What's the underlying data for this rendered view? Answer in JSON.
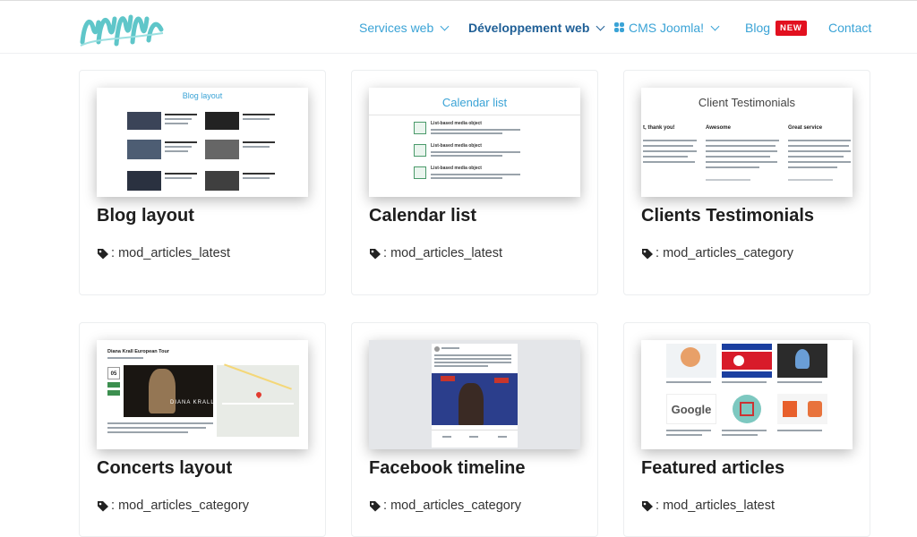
{
  "nav": {
    "items": [
      {
        "label": "Services web"
      },
      {
        "label": "Développement web"
      },
      {
        "label": "CMS Joomla!"
      },
      {
        "label": "Blog",
        "badge": "NEW"
      },
      {
        "label": "Contact"
      }
    ]
  },
  "cards": [
    {
      "title": "Blog layout",
      "tag_prefix": ":",
      "tag": "mod_articles_latest",
      "thumb_heading": "Blog layout"
    },
    {
      "title": "Calendar list",
      "tag_prefix": ":",
      "tag": "mod_articles_latest",
      "thumb_heading": "Calendar list"
    },
    {
      "title": "Clients Testimonials",
      "tag_prefix": ":",
      "tag": "mod_articles_category",
      "thumb_heading": "Client Testimonials"
    },
    {
      "title": "Concerts layout",
      "tag_prefix": ":",
      "tag": "mod_articles_category",
      "thumb_heading": "Diana Krall European Tour"
    },
    {
      "title": "Facebook timeline",
      "tag_prefix": ":",
      "tag": "mod_articles_category",
      "thumb_heading": ""
    },
    {
      "title": "Featured articles",
      "tag_prefix": ":",
      "tag": "mod_articles_latest",
      "thumb_heading": ""
    }
  ],
  "thumbs": {
    "calendar_items": [
      "List-based media object",
      "List-based media object",
      "List-based media object"
    ],
    "testimonial_cols": [
      "Awesome",
      "Great service"
    ],
    "testimonial_left": "t, thank you!",
    "concert_date": "05",
    "concert_name": "DIANA KRALL",
    "google_text": "Google"
  },
  "colors": {
    "link": "#3aa3d6",
    "active": "#1f5f96",
    "badge": "#e2101f"
  }
}
